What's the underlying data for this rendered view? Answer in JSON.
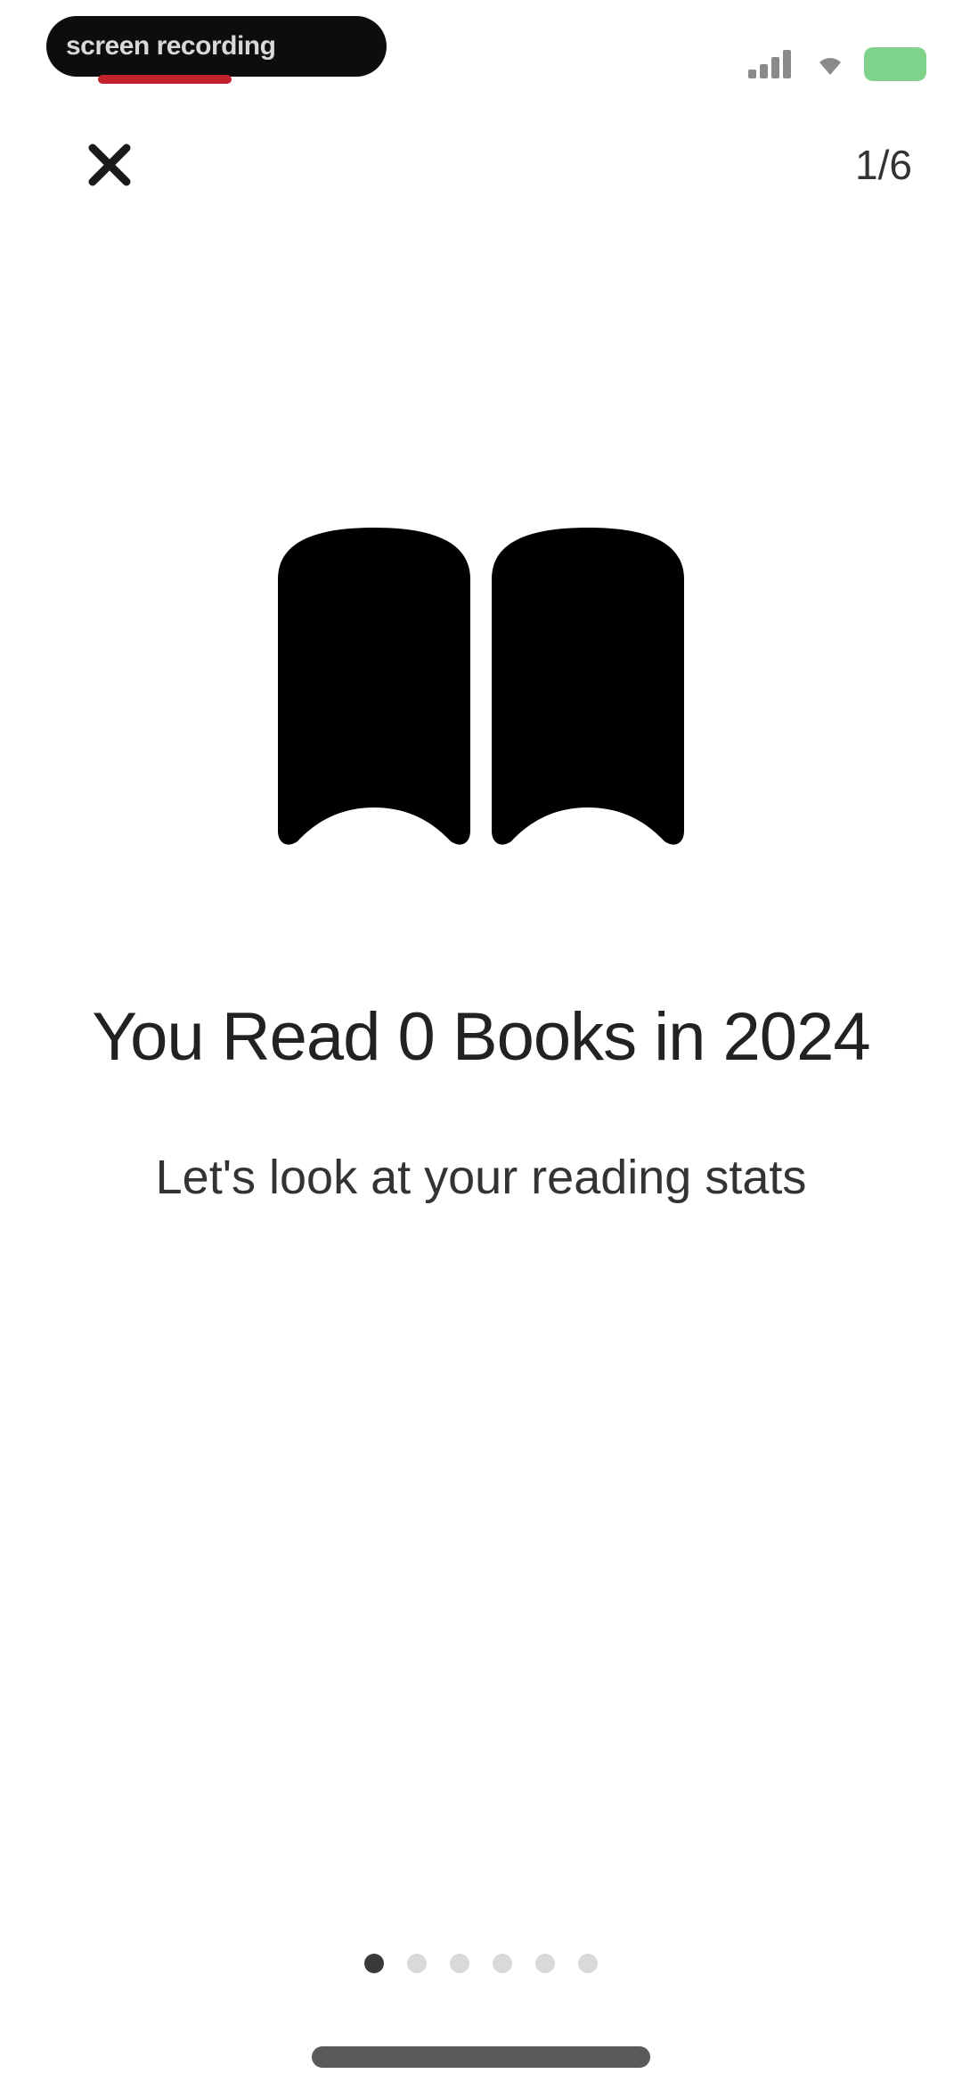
{
  "status_bar": {
    "left_pill_text": "screen recording",
    "signal_icon": "signal-bars-icon",
    "wifi_icon": "wifi-icon",
    "battery_icon": "battery-icon",
    "battery_color": "#7fd38a"
  },
  "header": {
    "close_icon": "close-icon",
    "page_counter": "1/6"
  },
  "hero": {
    "icon": "open-book-icon",
    "headline": "You Read 0 Books in 2024",
    "subtitle": "Let's look at your reading stats"
  },
  "pagination": {
    "total": 6,
    "active_index": 0
  }
}
